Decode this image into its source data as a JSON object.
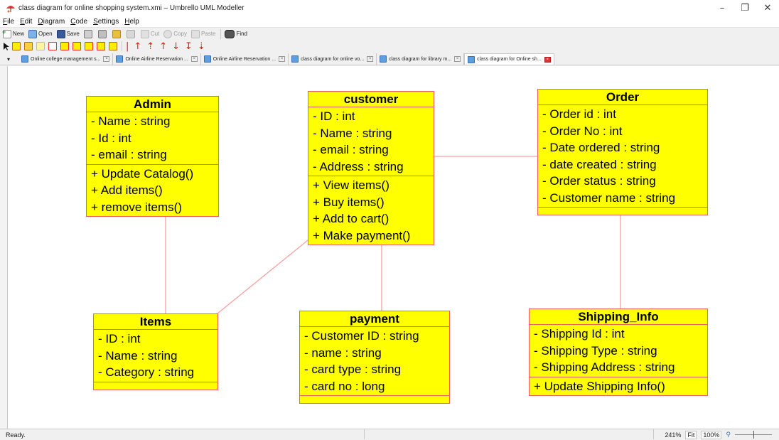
{
  "window": {
    "title": "class diagram for online shopping system.xmi – Umbrello UML Modeller",
    "controls": {
      "minimize": "–",
      "restore": "❐",
      "close": "✕"
    }
  },
  "menu": [
    "File",
    "Edit",
    "Diagram",
    "Code",
    "Settings",
    "Help"
  ],
  "toolbar": {
    "buttons": [
      {
        "label": "New",
        "icon": "new-icon",
        "enabled": true
      },
      {
        "label": "Open",
        "icon": "open-icon",
        "enabled": true
      },
      {
        "label": "Save",
        "icon": "save-icon",
        "enabled": true
      },
      {
        "label": "",
        "icon": "print-icon",
        "enabled": true
      },
      {
        "label": "",
        "icon": "print-preview-icon",
        "enabled": true
      },
      {
        "label": "",
        "icon": "undo-icon",
        "enabled": true
      },
      {
        "label": "",
        "icon": "redo-icon",
        "enabled": false
      },
      {
        "label": "Cut",
        "icon": "cut-icon",
        "enabled": false
      },
      {
        "label": "Copy",
        "icon": "copy-icon",
        "enabled": false
      },
      {
        "label": "Paste",
        "icon": "paste-icon",
        "enabled": false
      },
      {
        "label": "Find",
        "icon": "find-icon",
        "enabled": true
      }
    ]
  },
  "tabs": [
    {
      "label": "Online college management s...",
      "active": false
    },
    {
      "label": "Online Airline Reservation ...",
      "active": false
    },
    {
      "label": "Online Airline Reservation ...",
      "active": false
    },
    {
      "label": "class diagram for online vo...",
      "active": false
    },
    {
      "label": "class diagram for library m...",
      "active": false
    },
    {
      "label": "class diagram for Online sh...",
      "active": true
    }
  ],
  "diagram": {
    "classes": {
      "admin": {
        "name": "Admin",
        "attributes": [
          "- Name : string",
          "- Id : int",
          "- email : string"
        ],
        "operations": [
          "+ Update Catalog()",
          "+ Add items()",
          "+ remove items()"
        ]
      },
      "customer": {
        "name": "customer",
        "attributes": [
          "- ID : int",
          "- Name : string",
          "- email : string",
          "- Address : string"
        ],
        "operations": [
          "+ View items()",
          "+ Buy items()",
          "+ Add to cart()",
          "+ Make payment()"
        ]
      },
      "order": {
        "name": "Order",
        "attributes": [
          "- Order id : int",
          "- Order No : int",
          "- Date ordered : string",
          "- date created : string",
          "- Order status : string",
          "- Customer name : string"
        ],
        "operations": []
      },
      "items": {
        "name": "Items",
        "attributes": [
          "- ID : int",
          "- Name : string",
          "- Category : string"
        ],
        "operations": []
      },
      "payment": {
        "name": "payment",
        "attributes": [
          "- Customer ID : string",
          "- name : string",
          "- card type : string",
          "- card no : long"
        ],
        "operations": []
      },
      "shipping": {
        "name": "Shipping_Info",
        "attributes": [
          "- Shipping Id : int",
          "- Shipping Type : string",
          "- Shipping Address : string"
        ],
        "operations": [
          "+ Update Shipping Info()"
        ]
      }
    },
    "colors": {
      "class_fill": "#ffff00",
      "class_border": "#f06060",
      "association": "#f4a0a0"
    }
  },
  "status": {
    "text": "Ready.",
    "zoom": "241%",
    "fit_label": "Fit",
    "zoom_100_label": "100%"
  }
}
